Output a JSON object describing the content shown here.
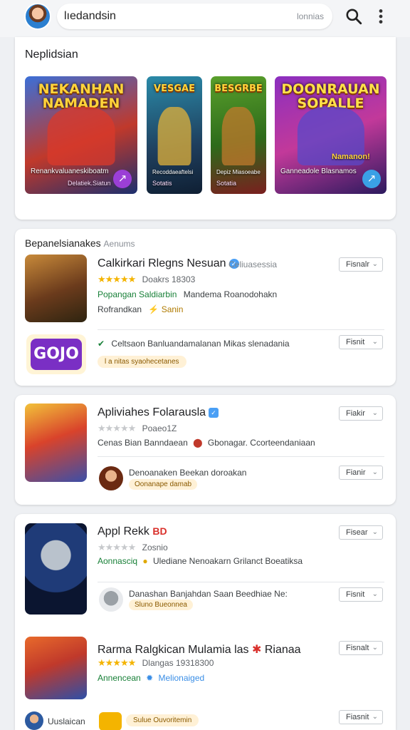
{
  "header": {
    "search_value": "lıedandsin",
    "search_hint": "lonnias"
  },
  "featured": {
    "title": "Neplidsian",
    "banners": [
      {
        "title": "NEKANHAN NAMADEN",
        "subtitle": "Renankvaluaneskiboatm",
        "subtitle2": "Delatiek.Siatun",
        "color": "#3b6fd8"
      },
      {
        "title": "VESGAE",
        "subtitle": "Recoddaeaftelsi",
        "subtitle2": "Sotatis",
        "color": "#2a8aa8"
      },
      {
        "title": "BESGRBE",
        "subtitle": "Depiz Miasoeabe",
        "subtitle2": "Sotatia",
        "color": "#5aa02c"
      },
      {
        "title": "DOONRAUAN SOPALLE",
        "subtitle": "Ganneadole Blasnamos",
        "subtitle2": "Namanon!",
        "color": "#8b2fc0"
      }
    ]
  },
  "section": {
    "title": "Bepanelsianakes",
    "subtitle": "Aenums"
  },
  "apps": [
    {
      "name": "Calkirkari Rlegns Nesuan",
      "verified": true,
      "rating_stars": "★★★★★",
      "rating_text": "Doakrs 18303",
      "rating_extra": "Celiuasessia",
      "line1_green": "Popangan Saldiarbin",
      "line1_rest": "Mandema Roanodohakn",
      "line2": "Rofrandkan",
      "line2_extra": "Sanin",
      "install_label": "Fisnalr",
      "sub": {
        "text": "Celtsaon Banluandamalanan Mikas slenadania",
        "tag": "l a nitas syaohecetanes",
        "install_label": "Fisnit",
        "icon_text": "GOJO"
      }
    },
    {
      "name": "Apliviahes Folarausla",
      "verified": true,
      "rating_stars": "★★★★★",
      "rating_text": "Poaeo1Z",
      "line1": "Cenas Bian Banndaean",
      "line1_extra": "Gbonagar. Ccorteendaniaan",
      "install_label": "Fiakir",
      "sub": {
        "text": "Denoanaken Beekan doroakan",
        "tag": "Oonanape damab",
        "install_label": "Fianir"
      }
    },
    {
      "name": "Appl Rekk",
      "badge": "BD",
      "rating_stars": "★★★★★",
      "rating_text": "Zosnio",
      "line1_green": "Aonnasciq",
      "line1_rest": "Ulediane Nenoakarn Grilanct Boeatiksa",
      "install_label": "Fisear",
      "sub": {
        "text": "Danashan Banjahdan Saan Beedhiae Ne:",
        "tag": "Sluno  Bueonnea",
        "install_label": "Fisnit"
      }
    },
    {
      "name": "Rarma Ralgkican Mulamia las",
      "name_extra": "Rianaa",
      "rating_stars": "★★★★★",
      "rating_text": "Dlangas 19318300",
      "line1_green": "Annencean",
      "line1_blue": "Melionaiged",
      "install_label": "Fisnalt"
    }
  ],
  "footer_row": {
    "name": "Uuslaican",
    "tag": "Sulue Ouvoritemin",
    "install_label": "Fiasnit"
  }
}
